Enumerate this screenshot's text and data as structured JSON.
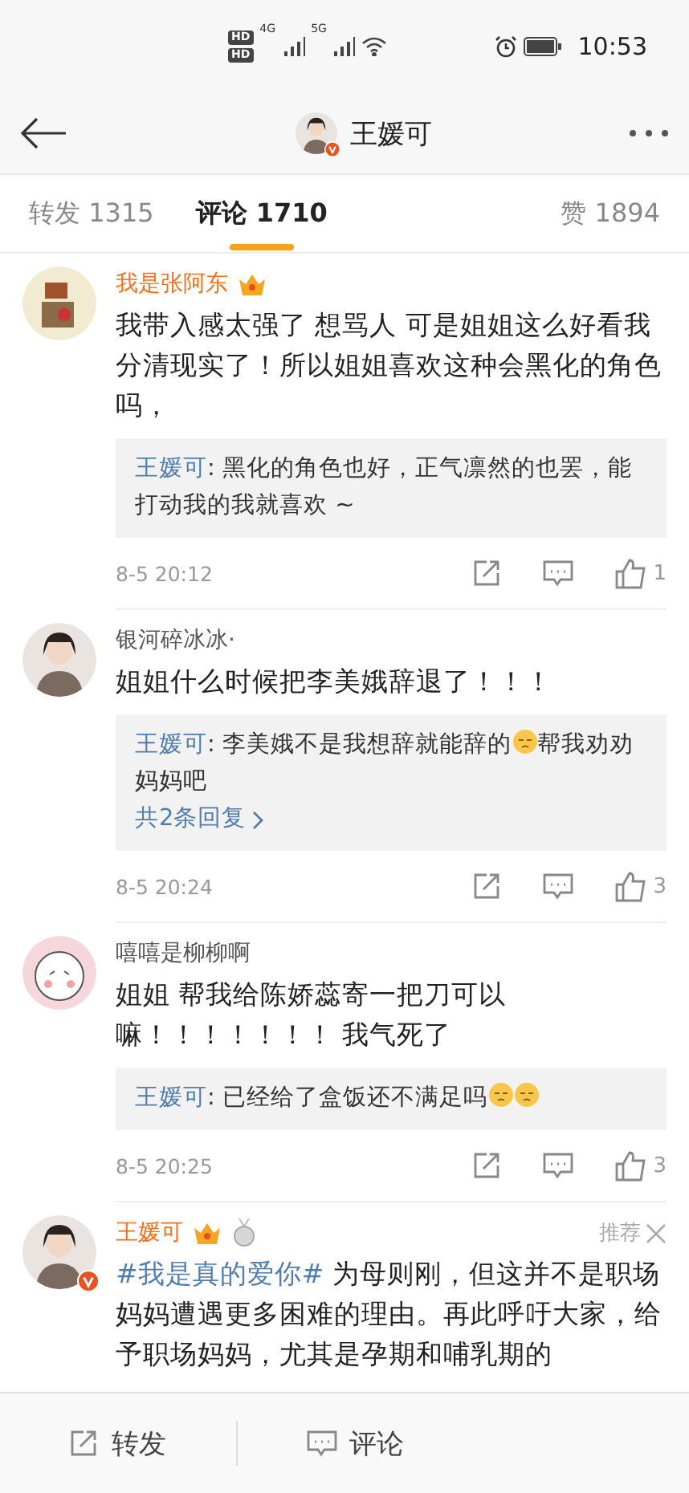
{
  "status_bar": {
    "sim_labels": [
      "HD",
      "HD"
    ],
    "networks": [
      "4G",
      "5G"
    ],
    "time": "10:53"
  },
  "header": {
    "title": "王媛可",
    "verified": true
  },
  "tabs": [
    {
      "label": "转发 1315",
      "selected": false
    },
    {
      "label": "评论 1710",
      "selected": true
    },
    {
      "label": "赞 1894",
      "selected": false
    }
  ],
  "comments": [
    {
      "author": "我是张阿东",
      "member": true,
      "crown": true,
      "medal": false,
      "verified": false,
      "recommended": false,
      "segments": [
        {
          "kind": "text",
          "text": "我带入感太强了 想骂人 可是姐姐这么好看我分清现实了！所以姐姐喜欢这种会黑化的角色吗，"
        }
      ],
      "reply": {
        "author": "王媛可",
        "separator": ":",
        "segments": [
          {
            "kind": "text",
            "text": "黑化的角色也好，正气凛然的也罢，能打动我的我就喜欢 ~"
          }
        ]
      },
      "time": "8-5 20:12",
      "likes": "1"
    },
    {
      "author": "银河碎冰冰·",
      "member": false,
      "crown": false,
      "medal": false,
      "verified": false,
      "recommended": false,
      "segments": [
        {
          "kind": "text",
          "text": "姐姐什么时候把李美娥辞退了！！！"
        }
      ],
      "reply": {
        "author": "王媛可",
        "separator": ":",
        "segments": [
          {
            "kind": "text",
            "text": "李美娥不是我想辞就能辞的"
          },
          {
            "kind": "emoji"
          },
          {
            "kind": "text",
            "text": "帮我劝劝妈妈吧"
          }
        ],
        "more": "共2条回复"
      },
      "time": "8-5 20:24",
      "likes": "3"
    },
    {
      "author": "嘻嘻是柳柳啊",
      "member": false,
      "crown": false,
      "medal": false,
      "verified": false,
      "recommended": false,
      "segments": [
        {
          "kind": "text",
          "text": "姐姐 帮我给陈娇蕊寄一把刀可以嘛！！！！！！！ 我气死了"
        }
      ],
      "reply": {
        "author": "王媛可",
        "separator": ":",
        "segments": [
          {
            "kind": "text",
            "text": "已经给了盒饭还不满足吗"
          },
          {
            "kind": "emoji"
          },
          {
            "kind": "emoji"
          }
        ]
      },
      "time": "8-5 20:25",
      "likes": "3"
    },
    {
      "author": "王媛可",
      "member": true,
      "crown": true,
      "medal": true,
      "verified": true,
      "recommended": true,
      "recommend_label": "推荐",
      "segments": [
        {
          "kind": "hashtag",
          "text": "#我是真的爱你#"
        },
        {
          "kind": "text",
          "text": " 为母则刚，但这并不是职场妈妈遭遇更多困难的理由。再此呼吁大家，给予职场妈妈，尤其是孕期和哺乳期的"
        }
      ]
    }
  ],
  "bottom_bar": [
    {
      "kind": "repost",
      "label": "转发"
    },
    {
      "kind": "comment",
      "label": "评论"
    }
  ]
}
